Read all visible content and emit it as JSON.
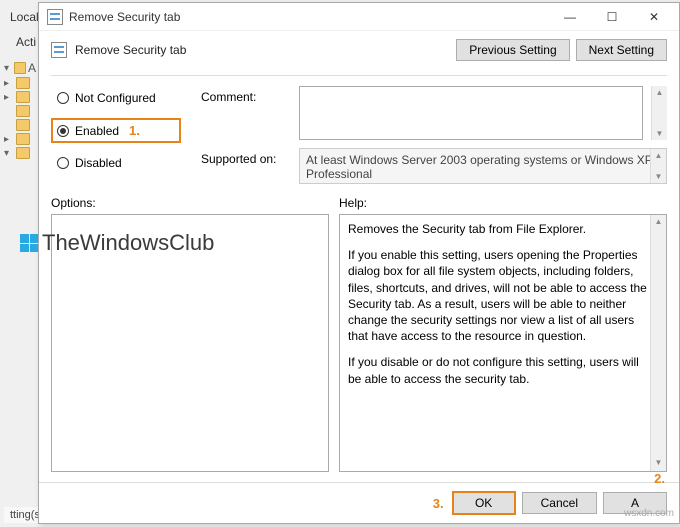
{
  "bg": {
    "title": "Local Gr",
    "action": "Acti",
    "tree_label": "A",
    "footer": "tting(s)"
  },
  "titlebar": {
    "title": "Remove Security tab"
  },
  "header": {
    "policy_title": "Remove Security tab",
    "previous": "Previous Setting",
    "next": "Next Setting"
  },
  "radios": {
    "not_configured": "Not Configured",
    "enabled": "Enabled",
    "disabled": "Disabled",
    "selected": "enabled"
  },
  "annotations": {
    "a1": "1.",
    "a2": "2.",
    "a3": "3."
  },
  "labels": {
    "comment": "Comment:",
    "supported": "Supported on:",
    "options": "Options:",
    "help": "Help:"
  },
  "fields": {
    "comment_value": "",
    "supported_text": "At least Windows Server 2003 operating systems or Windows XP Professional"
  },
  "help": {
    "p1": "Removes the Security tab from File Explorer.",
    "p2": "If you enable this setting, users opening the Properties dialog box for all file system objects, including folders, files, shortcuts, and drives, will not be able to access the Security tab. As a result, users will be able to neither change the security settings nor view a list of all users that have access to the resource in question.",
    "p3": "If you disable or do not configure this setting, users will be able to access the security tab."
  },
  "footer": {
    "ok": "OK",
    "cancel": "Cancel",
    "apply": "A"
  },
  "watermark": "TheWindowsClub",
  "site_watermark": "wsxdn.com"
}
